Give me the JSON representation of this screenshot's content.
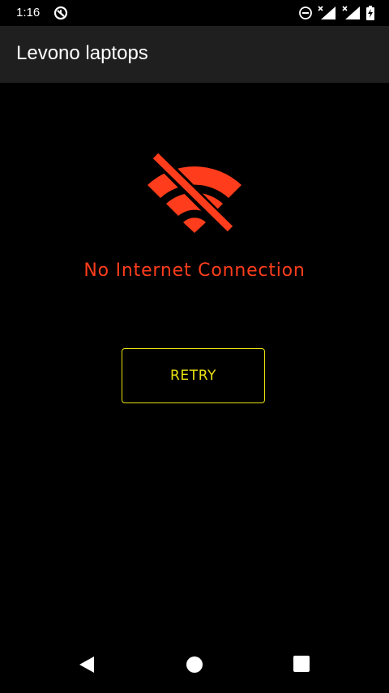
{
  "status_bar": {
    "time": "1:16",
    "left_icon": "data-saver-icon",
    "right_icons": [
      "do-not-disturb-icon",
      "wifi-signal-x-icon",
      "cell-signal-x-icon",
      "battery-charging-icon"
    ]
  },
  "app_bar": {
    "title": "Levono laptops"
  },
  "content": {
    "icon": "wifi-off-icon",
    "error_message": "No Internet Connection",
    "retry_label": "RETRY"
  },
  "colors": {
    "accent_error": "#ff3d1c",
    "accent_button": "#e8e010",
    "app_bar_bg": "#1f1f1f",
    "background": "#000000"
  },
  "nav_bar": {
    "icons": [
      "back-icon",
      "home-icon",
      "recents-icon"
    ]
  }
}
